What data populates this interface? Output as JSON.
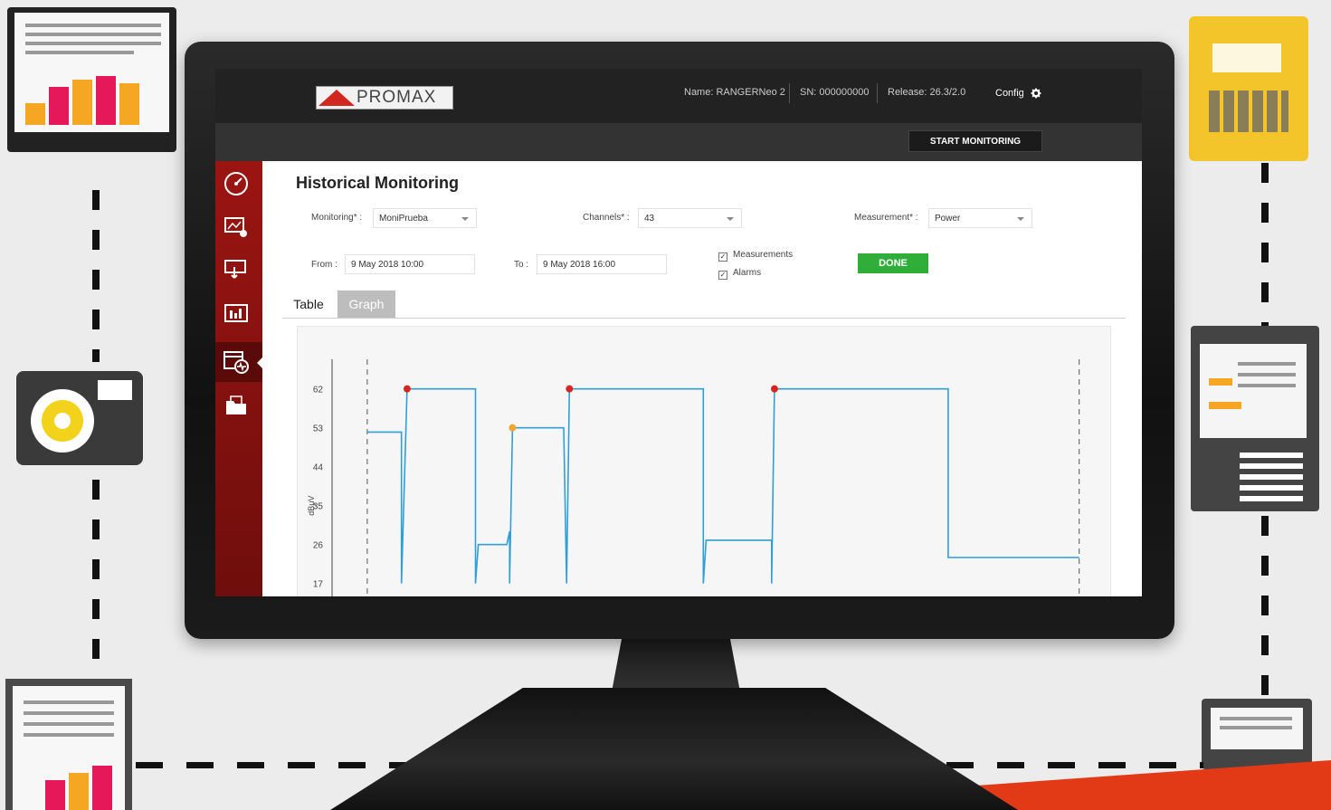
{
  "app": {
    "brand": "PROMAX",
    "device_name": "Name: RANGERNeo 2",
    "serial": "SN: 000000000",
    "release": "Release: 26.3/2.0",
    "config_label": "Config",
    "start_label": "START MONITORING"
  },
  "page": {
    "title": "Historical Monitoring",
    "monitoring_label": "Monitoring* :",
    "monitoring_value": "MoniPrueba",
    "channels_label": "Channels* :",
    "channels_value": "43",
    "measurement_label": "Measurement* :",
    "measurement_value": "Power",
    "from_label": "From :",
    "from_value": "9 May 2018 10:00",
    "to_label": "To :",
    "to_value": "9 May 2018 16:00",
    "chk_measurements": "Measurements",
    "chk_alarms": "Alarms",
    "done_label": "DONE",
    "tabs": [
      {
        "label": "Table",
        "active": false
      },
      {
        "label": "Graph",
        "active": true
      }
    ]
  },
  "sidebar_icons": [
    "gauge-icon",
    "monitor-settings-icon",
    "touch-screen-icon",
    "spectrum-icon",
    "calendar-monitoring-icon",
    "folder-icon"
  ],
  "colors": {
    "accent": "#9b1512",
    "done": "#2fae3a",
    "line": "#2f9fd8",
    "alarm": "#d7261e",
    "warning": "#f0a830"
  },
  "chart_data": {
    "type": "line",
    "ylabel": "dBμV",
    "yticks": [
      62,
      53,
      44,
      35,
      26,
      17
    ],
    "ylim": [
      14,
      68
    ],
    "series": [
      {
        "points": [
          [
            0,
            52
          ],
          [
            0.6,
            52
          ],
          [
            0.6,
            17
          ],
          [
            0.7,
            62
          ],
          [
            1.9,
            62
          ],
          [
            1.9,
            17
          ],
          [
            1.95,
            26
          ],
          [
            2.45,
            26
          ],
          [
            2.5,
            29
          ],
          [
            2.5,
            17
          ],
          [
            2.55,
            53
          ],
          [
            3.45,
            53
          ],
          [
            3.5,
            17
          ],
          [
            3.55,
            62
          ],
          [
            5.9,
            62
          ],
          [
            5.9,
            17
          ],
          [
            5.95,
            27
          ],
          [
            7.1,
            27
          ],
          [
            7.1,
            17
          ],
          [
            7.15,
            62
          ],
          [
            10.2,
            62
          ],
          [
            10.2,
            23
          ],
          [
            12.5,
            23
          ]
        ]
      }
    ],
    "markers": [
      {
        "x": 0.7,
        "y": 62,
        "kind": "alarm"
      },
      {
        "x": 2.55,
        "y": 53,
        "kind": "warning"
      },
      {
        "x": 3.55,
        "y": 62,
        "kind": "alarm"
      },
      {
        "x": 7.15,
        "y": 62,
        "kind": "alarm"
      }
    ],
    "xlim": [
      -0.3,
      12.6
    ],
    "dashed_x": [
      0,
      12.5
    ]
  }
}
